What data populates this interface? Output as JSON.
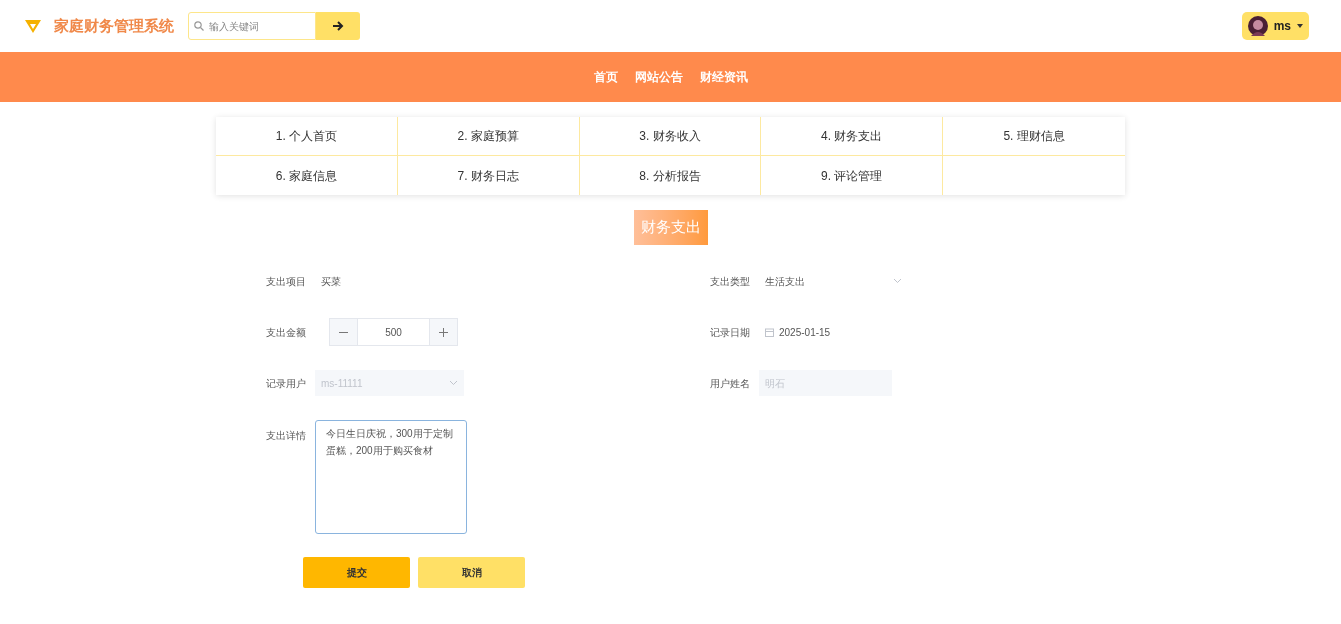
{
  "header": {
    "title": "家庭财务管理系统",
    "search": {
      "placeholder": "输入关键词"
    },
    "user": {
      "name": "ms"
    }
  },
  "nav": [
    "首页",
    "网站公告",
    "财经资讯"
  ],
  "menu": [
    "1. 个人首页",
    "2. 家庭预算",
    "3. 财务收入",
    "4. 财务支出",
    "5. 理财信息",
    "6. 家庭信息",
    "7. 财务日志",
    "8. 分析报告",
    "9. 评论管理"
  ],
  "page_title": "财务支出",
  "fields": [
    {
      "label": "支出项目",
      "kind": "text",
      "value": "买菜",
      "disabled": false
    },
    {
      "label": "支出类型",
      "kind": "select",
      "value": "生活支出",
      "disabled": false
    },
    {
      "label": "支出金额",
      "kind": "number",
      "value": "500",
      "disabled": false
    },
    {
      "label": "记录日期",
      "kind": "date",
      "value": "2025-01-15",
      "disabled": false
    },
    {
      "label": "记录用户",
      "kind": "select",
      "value": "ms-11111",
      "disabled": true
    },
    {
      "label": "用户姓名",
      "kind": "text",
      "value": "明石",
      "disabled": true
    },
    {
      "label": "支出详情",
      "kind": "textarea",
      "value": "今日生日庆祝，300用于定制蛋糕，200用于购买食材",
      "disabled": false
    }
  ],
  "buttons": [
    {
      "label": "提交",
      "kind": "primary"
    },
    {
      "label": "取消",
      "kind": "secondary"
    }
  ]
}
